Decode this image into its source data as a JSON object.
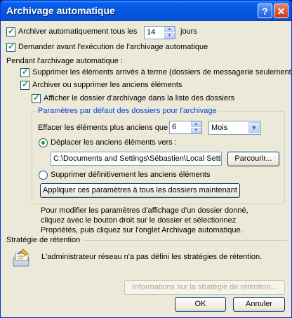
{
  "window": {
    "title": "Archivage automatique",
    "help_glyph": "?",
    "close_glyph": "✕"
  },
  "options": {
    "auto_archive": {
      "label": "Archiver automatiquement tous les",
      "checked": true
    },
    "days_value": "14",
    "days_unit": "jours",
    "prompt_before": {
      "label": "Demander avant l'exécution de l'archivage automatique",
      "checked": true
    },
    "during_header": "Pendant l'archivage automatique :",
    "delete_expired": {
      "label": "Supprimer les éléments arrivés à terme (dossiers de messagerie seulement)",
      "checked": true
    },
    "archive_old": {
      "label": "Archiver ou supprimer les anciens éléments",
      "checked": true
    },
    "show_folder": {
      "label": "Afficher le dossier d'archivage dans la liste des dossiers",
      "checked": true
    }
  },
  "defaults_group": {
    "title": "Paramètres par défaut des dossiers pour l'archivage",
    "clean_label": "Effacer les éléments plus anciens que",
    "clean_value": "6",
    "period_value": "Mois",
    "move_radio": "Déplacer les anciens éléments vers :",
    "path_value": "C:\\Documents and Settings\\Sébastien\\Local Settings\\Application Data",
    "browse_button": "Parcourir...",
    "delete_radio": "Supprimer définitivement les anciens éléments",
    "apply_button": "Appliquer ces paramètres à tous les dossiers maintenant"
  },
  "info_text": [
    "Pour modifier les paramètres d'affichage d'un dossier donné,",
    "cliquez avec le bouton droit sur le dossier et sélectionnez",
    "Propriétés, puis cliquez sur l'onglet Archivage automatique."
  ],
  "retention": {
    "header": "Stratégie de rétention",
    "message": "L'administrateur réseau n'a pas défini les stratégies de rétention.",
    "info_button": "Informations sur la stratégie de rétention..."
  },
  "buttons": {
    "ok": "OK",
    "cancel": "Annuler"
  },
  "colors": {
    "titlebar": "#0458e2",
    "dialog_bg": "#ece9d8",
    "group_title": "#0046d5",
    "check": "#21a121"
  }
}
